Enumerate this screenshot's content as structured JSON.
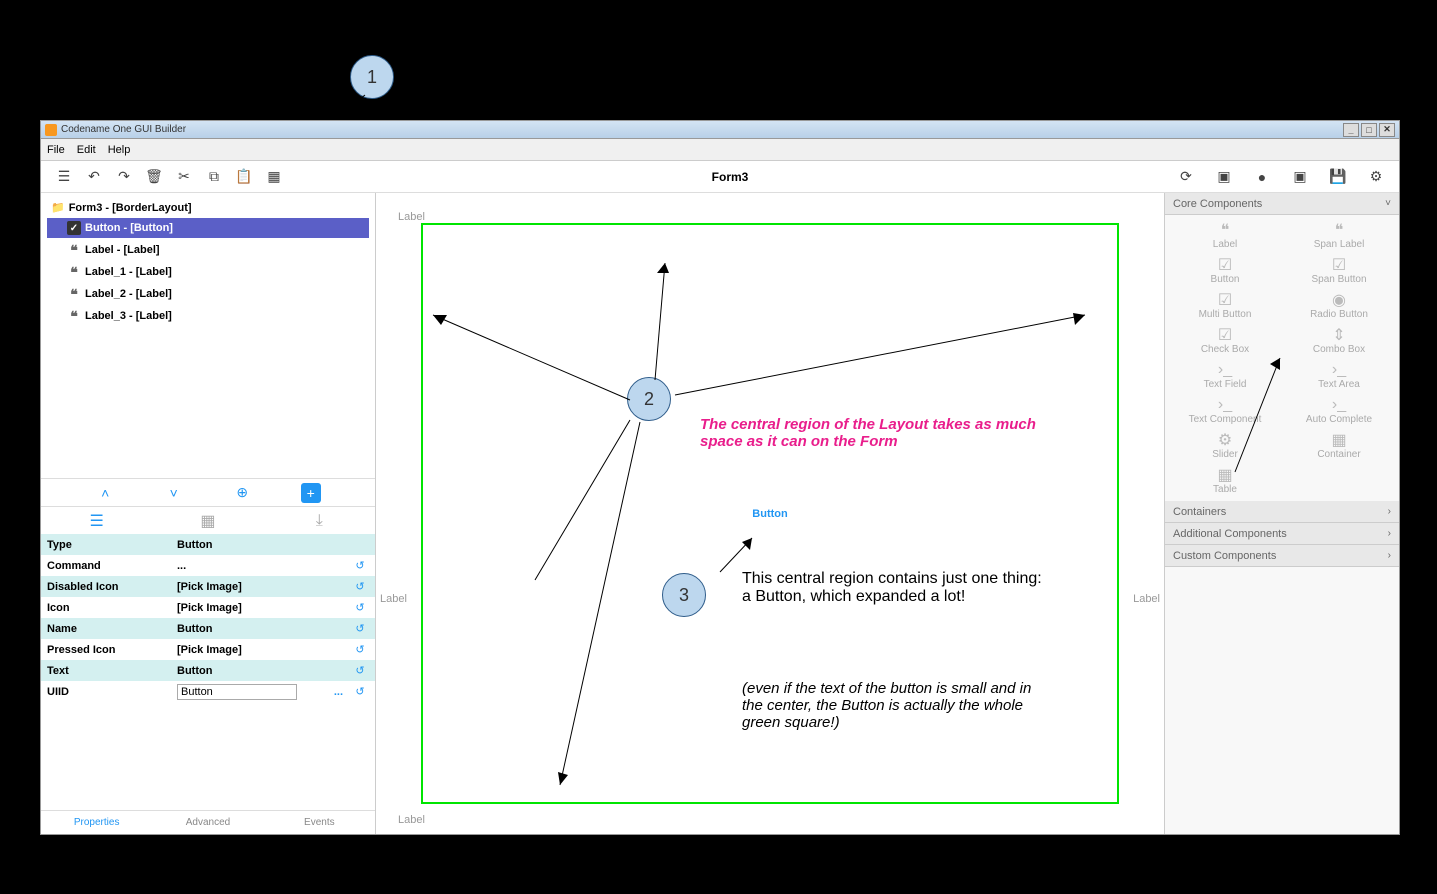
{
  "window": {
    "title": "Codename One GUI Builder"
  },
  "menubar": {
    "items": [
      "File",
      "Edit",
      "Help"
    ]
  },
  "toolbar": {
    "formTitle": "Form3"
  },
  "tree": {
    "root": "Form3 - [BorderLayout]",
    "items": [
      {
        "label": "Button - [Button]",
        "type": "button",
        "selected": true
      },
      {
        "label": "Label - [Label]",
        "type": "label",
        "selected": false
      },
      {
        "label": "Label_1 - [Label]",
        "type": "label",
        "selected": false
      },
      {
        "label": "Label_2 - [Label]",
        "type": "label",
        "selected": false
      },
      {
        "label": "Label_3 - [Label]",
        "type": "label",
        "selected": false
      }
    ]
  },
  "properties": {
    "rows": [
      {
        "key": "Type",
        "value": "Button",
        "alt": true,
        "reset": false
      },
      {
        "key": "Command",
        "value": "...",
        "alt": false,
        "reset": true
      },
      {
        "key": "Disabled Icon",
        "value": "[Pick Image]",
        "alt": true,
        "reset": true
      },
      {
        "key": "Icon",
        "value": "[Pick Image]",
        "alt": false,
        "reset": true
      },
      {
        "key": "Name",
        "value": "Button",
        "alt": true,
        "reset": true
      },
      {
        "key": "Pressed Icon",
        "value": "[Pick Image]",
        "alt": false,
        "reset": true
      },
      {
        "key": "Text",
        "value": "Button",
        "alt": true,
        "reset": true
      }
    ],
    "uiid": {
      "key": "UIID",
      "value": "Button"
    }
  },
  "bottomTabs": [
    "Properties",
    "Advanced",
    "Events"
  ],
  "canvas": {
    "labelTop": "Label",
    "labelLeft": "Label",
    "labelRight": "Label",
    "labelBottom": "Label",
    "buttonText": "Button"
  },
  "palette": {
    "sections": [
      {
        "title": "Core Components",
        "open": true
      },
      {
        "title": "Containers",
        "open": false
      },
      {
        "title": "Additional Components",
        "open": false
      },
      {
        "title": "Custom Components",
        "open": false
      }
    ],
    "coreItems": [
      {
        "label": "Label",
        "icon": "❝"
      },
      {
        "label": "Span Label",
        "icon": "❝"
      },
      {
        "label": "Button",
        "icon": "☑"
      },
      {
        "label": "Span Button",
        "icon": "☑"
      },
      {
        "label": "Multi Button",
        "icon": "☑"
      },
      {
        "label": "Radio Button",
        "icon": "◉"
      },
      {
        "label": "Check Box",
        "icon": "☑"
      },
      {
        "label": "Combo Box",
        "icon": "⇕"
      },
      {
        "label": "Text Field",
        "icon": ">_"
      },
      {
        "label": "Text Area",
        "icon": ">_"
      },
      {
        "label": "Text Component",
        "icon": ">_"
      },
      {
        "label": "Auto Complete",
        "icon": ">_"
      },
      {
        "label": "Slider",
        "icon": "⚙"
      },
      {
        "label": "Container",
        "icon": "▦"
      },
      {
        "label": "Table",
        "icon": "▦"
      }
    ]
  },
  "annotations": {
    "n1": "1",
    "n2": "2",
    "n3": "3",
    "text2": "The central region of the Layout takes as much space as it can on the Form",
    "text3a": "This central region contains just one thing: a Button, which expanded a lot!",
    "text3b": "(even if the text of the button is small and in the center, the Button is actually the whole green square!)"
  }
}
